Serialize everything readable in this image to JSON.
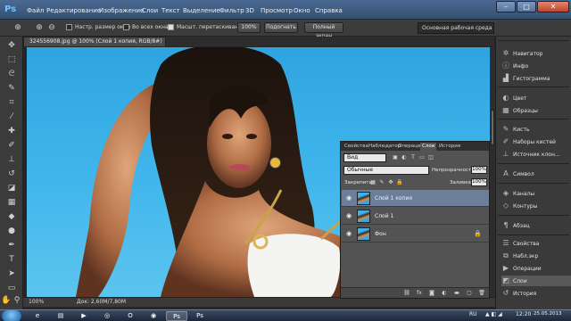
{
  "app": {
    "logo": "Ps",
    "menu": [
      "Файл",
      "Редактирование",
      "Изображение",
      "Слои",
      "Текст",
      "Выделение",
      "Фильтр",
      "3D",
      "Просмотр",
      "Окно",
      "Справка"
    ],
    "window_controls": [
      "–",
      "□",
      "✕"
    ]
  },
  "options": {
    "resize_windows_label": "Настр. размер окон",
    "all_windows_label": "Во всех окнах",
    "scrubby_zoom_label": "Масшт. перетаскиванием",
    "zoom_100_label": "100%",
    "fit_screen_label": "Подогнать",
    "fill_screen_label": "Полный экран",
    "workspace": "Основная рабочая среда"
  },
  "document": {
    "tab_title": "324556908.jpg @ 100% (Слой 1 копия, RGB/8#) *",
    "zoom": "100%",
    "doc_size": "Док: 2,60M/7,80M"
  },
  "dock": {
    "items": [
      {
        "label": "Навигатор",
        "icon": "compass-icon"
      },
      {
        "label": "Инфо",
        "icon": "info-icon"
      },
      {
        "label": "Гистограмма",
        "icon": "histogram-icon"
      },
      {
        "label": "Цвет",
        "icon": "color-icon"
      },
      {
        "label": "Образцы",
        "icon": "swatches-icon"
      },
      {
        "label": "Кисть",
        "icon": "brush-icon"
      },
      {
        "label": "Наборы кистей",
        "icon": "brush-presets-icon"
      },
      {
        "label": "Источник клон...",
        "icon": "clone-source-icon"
      },
      {
        "label": "Символ",
        "icon": "character-icon"
      },
      {
        "label": "Каналы",
        "icon": "channels-icon"
      },
      {
        "label": "Контуры",
        "icon": "paths-icon"
      },
      {
        "label": "Абзац",
        "icon": "paragraph-icon"
      },
      {
        "label": "Свойства",
        "icon": "properties-icon"
      },
      {
        "label": "Набл.экр",
        "icon": "layer-comps-icon"
      },
      {
        "label": "Операции",
        "icon": "actions-icon"
      },
      {
        "label": "Слои",
        "icon": "layers-icon"
      },
      {
        "label": "История",
        "icon": "history-icon"
      }
    ]
  },
  "layers_panel": {
    "tabs": [
      "Свойства",
      "Наблюдатор",
      "Операции",
      "Слои",
      "История"
    ],
    "active_tab": "Слои",
    "kind_filter": "Вид",
    "blend_mode": "Обычные",
    "opacity_label": "Непрозрачность:",
    "opacity_value": "100%",
    "lock_label": "Закрепить:",
    "fill_label": "Заливка:",
    "fill_value": "100%",
    "layers": [
      {
        "name": "Слой 1 копия",
        "selected": true,
        "locked": false
      },
      {
        "name": "Слой 1",
        "selected": false,
        "locked": false
      },
      {
        "name": "Фон",
        "selected": false,
        "locked": true
      }
    ]
  },
  "taskbar": {
    "lang": "RU",
    "time": "12:20",
    "date": "25.05.2013"
  }
}
